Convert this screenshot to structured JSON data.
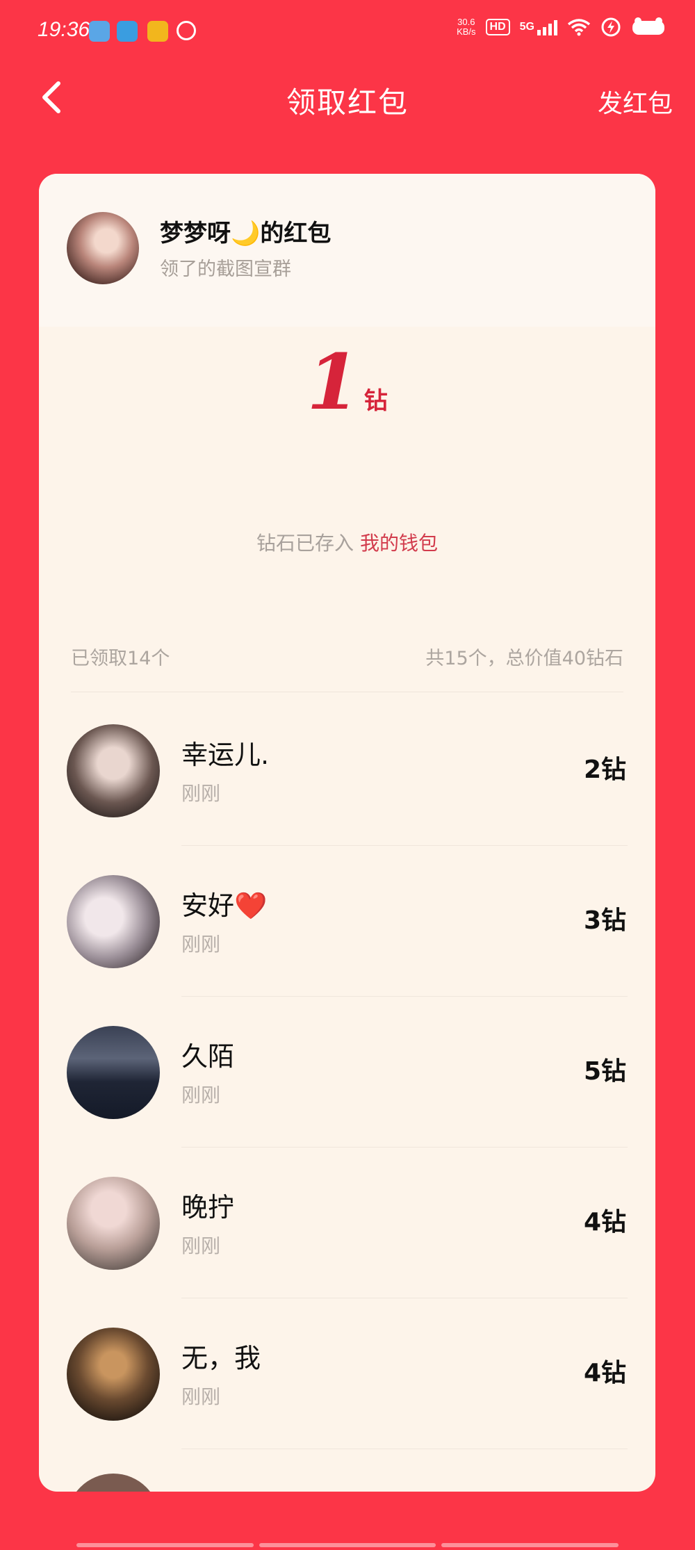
{
  "status_bar": {
    "time": "19:36",
    "net_speed_value": "30.6",
    "net_speed_unit": "KB/s",
    "hd": "HD",
    "signal": "5G"
  },
  "nav": {
    "title": "领取红包",
    "action": "发红包"
  },
  "packet": {
    "sender_name": "梦梦呀🌙的红包",
    "sender_sub": "领了的截图宣群",
    "amount": "1",
    "unit": "钻",
    "saved_prefix": "钻石已存入 ",
    "saved_link": "我的钱包",
    "claimed_count": "已领取14个",
    "total": "共15个，总价值40钻石"
  },
  "recipients": [
    {
      "name": "幸运儿.",
      "time": "刚刚",
      "amount": "2钻"
    },
    {
      "name": "安好❤️",
      "time": "刚刚",
      "amount": "3钻"
    },
    {
      "name": "久陌",
      "time": "刚刚",
      "amount": "5钻"
    },
    {
      "name": "晚拧",
      "time": "刚刚",
      "amount": "4钻"
    },
    {
      "name": "无，我",
      "time": "刚刚",
      "amount": "4钻"
    }
  ],
  "colors": {
    "background": "#fc3547",
    "card": "#fdf4ea",
    "accent": "#d6243a"
  }
}
